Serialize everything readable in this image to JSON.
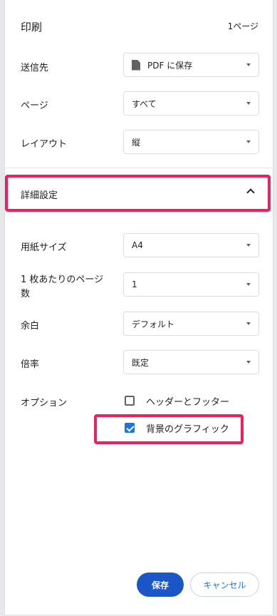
{
  "header": {
    "title": "印刷",
    "page_count": "1ページ"
  },
  "destination": {
    "label": "送信先",
    "value": "PDF に保存",
    "icon": "file-icon"
  },
  "pages": {
    "label": "ページ",
    "value": "すべて"
  },
  "layout": {
    "label": "レイアウト",
    "value": "縦"
  },
  "details": {
    "label": "詳細設定",
    "state": "expanded"
  },
  "paper_size": {
    "label": "用紙サイズ",
    "value": "A4"
  },
  "pages_per_sheet": {
    "label_line1": "1 枚あたりのページ",
    "label_line2": "数",
    "value": "1"
  },
  "margins": {
    "label": "余白",
    "value": "デフォルト"
  },
  "scale": {
    "label": "倍率",
    "value": "既定"
  },
  "options": {
    "label": "オプション",
    "headers_footers": {
      "label": "ヘッダーとフッター",
      "checked": false
    },
    "background_graphics": {
      "label": "背景のグラフィック",
      "checked": true
    }
  },
  "footer": {
    "save_label": "保存",
    "cancel_label": "キャンセル"
  },
  "colors": {
    "accent": "#1a73e8",
    "primary_button": "#1a56c8",
    "highlight": "#e8215f"
  }
}
